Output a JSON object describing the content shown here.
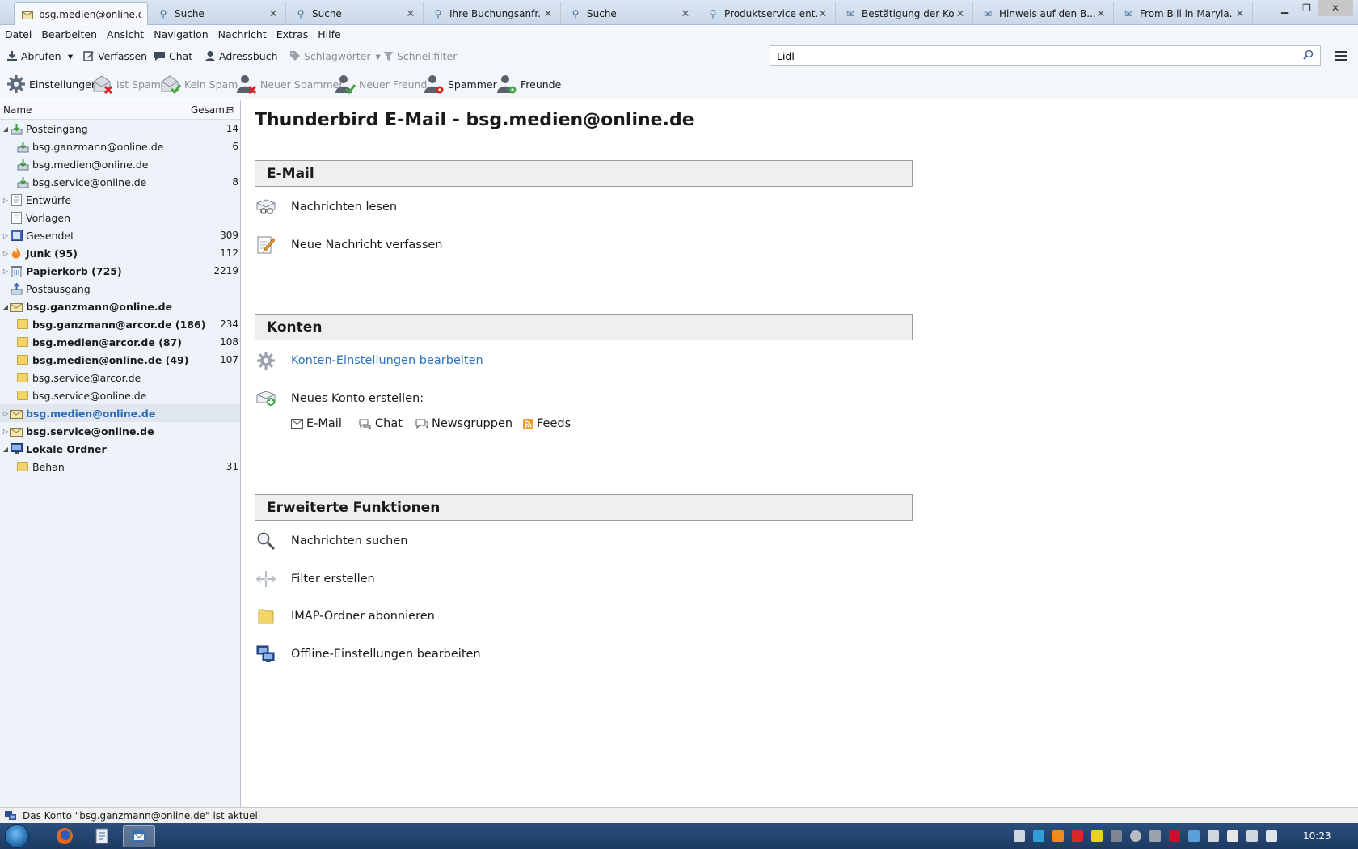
{
  "tabs": [
    {
      "label": "bsg.medien@online.de",
      "icon": "mail-folder-icon",
      "active": true
    },
    {
      "label": "Suche",
      "icon": "search-icon"
    },
    {
      "label": "Suche",
      "icon": "search-icon"
    },
    {
      "label": "Ihre Buchungsanfr...",
      "icon": "search-icon"
    },
    {
      "label": "Suche",
      "icon": "search-icon"
    },
    {
      "label": "Produktservice ent...",
      "icon": "search-icon"
    },
    {
      "label": "Bestätigung der Ko...",
      "icon": "envelope-icon"
    },
    {
      "label": "Hinweis auf den B...",
      "icon": "envelope-icon"
    },
    {
      "label": "From Bill in Maryla...",
      "icon": "envelope-icon"
    }
  ],
  "menubar": [
    "Datei",
    "Bearbeiten",
    "Ansicht",
    "Navigation",
    "Nachricht",
    "Extras",
    "Hilfe"
  ],
  "toolbar1": {
    "abrufen": "Abrufen",
    "verfassen": "Verfassen",
    "chat": "Chat",
    "adressbuch": "Adressbuch",
    "schlagwoerter": "Schlagwörter",
    "schnellfilter": "Schnellfilter",
    "search_value": "Lidl"
  },
  "toolbar2": {
    "einstellungen": "Einstellungen",
    "ist_spam": "Ist Spam",
    "kein_spam": "Kein Spam",
    "neuer_spammer": "Neuer Spammer",
    "neuer_freund": "Neuer Freund",
    "spammer": "Spammer",
    "freunde": "Freunde"
  },
  "folderpane": {
    "col_name": "Name",
    "col_total": "Gesamt",
    "rows": [
      {
        "label": "Posteingang",
        "count": "14"
      },
      {
        "label": "bsg.ganzmann@online.de",
        "count": "6"
      },
      {
        "label": "bsg.medien@online.de",
        "count": ""
      },
      {
        "label": "bsg.service@online.de",
        "count": "8"
      },
      {
        "label": "Entwürfe",
        "count": ""
      },
      {
        "label": "Vorlagen",
        "count": ""
      },
      {
        "label": "Gesendet",
        "count": "309"
      },
      {
        "label": "Junk (95)",
        "count": "112"
      },
      {
        "label": "Papierkorb (725)",
        "count": "2219"
      },
      {
        "label": "Postausgang",
        "count": ""
      },
      {
        "label": "bsg.ganzmann@online.de",
        "count": ""
      },
      {
        "label": "bsg.ganzmann@arcor.de (186)",
        "count": "234"
      },
      {
        "label": "bsg.medien@arcor.de (87)",
        "count": "108"
      },
      {
        "label": "bsg.medien@online.de (49)",
        "count": "107"
      },
      {
        "label": "bsg.service@arcor.de",
        "count": ""
      },
      {
        "label": "bsg.service@online.de",
        "count": ""
      },
      {
        "label": "bsg.medien@online.de",
        "count": ""
      },
      {
        "label": "bsg.service@online.de",
        "count": ""
      },
      {
        "label": "Lokale Ordner",
        "count": ""
      },
      {
        "label": "Behan",
        "count": "31"
      }
    ]
  },
  "content": {
    "title": "Thunderbird E-Mail - bsg.medien@online.de",
    "sections": {
      "email": "E-Mail",
      "konten": "Konten",
      "erweitert": "Erweiterte Funktionen"
    },
    "actions": {
      "lesen": "Nachrichten lesen",
      "verfassen": "Neue Nachricht verfassen",
      "konten_einstellungen": "Konten-Einstellungen bearbeiten",
      "neues_konto": "Neues Konto erstellen:",
      "suchen": "Nachrichten suchen",
      "filter": "Filter erstellen",
      "imap": "IMAP-Ordner abonnieren",
      "offline": "Offline-Einstellungen bearbeiten"
    },
    "new_account_types": [
      "E-Mail",
      "Chat",
      "Newsgruppen",
      "Feeds"
    ]
  },
  "statusbar": {
    "text": "Das Konto \"bsg.ganzmann@online.de\" ist aktuell"
  },
  "taskbar": {
    "clock": "10:23"
  },
  "colors": {
    "accent_link": "#2b73c2",
    "selected_folder": "#2a6bb8",
    "taskbar": "#1c3a62"
  }
}
